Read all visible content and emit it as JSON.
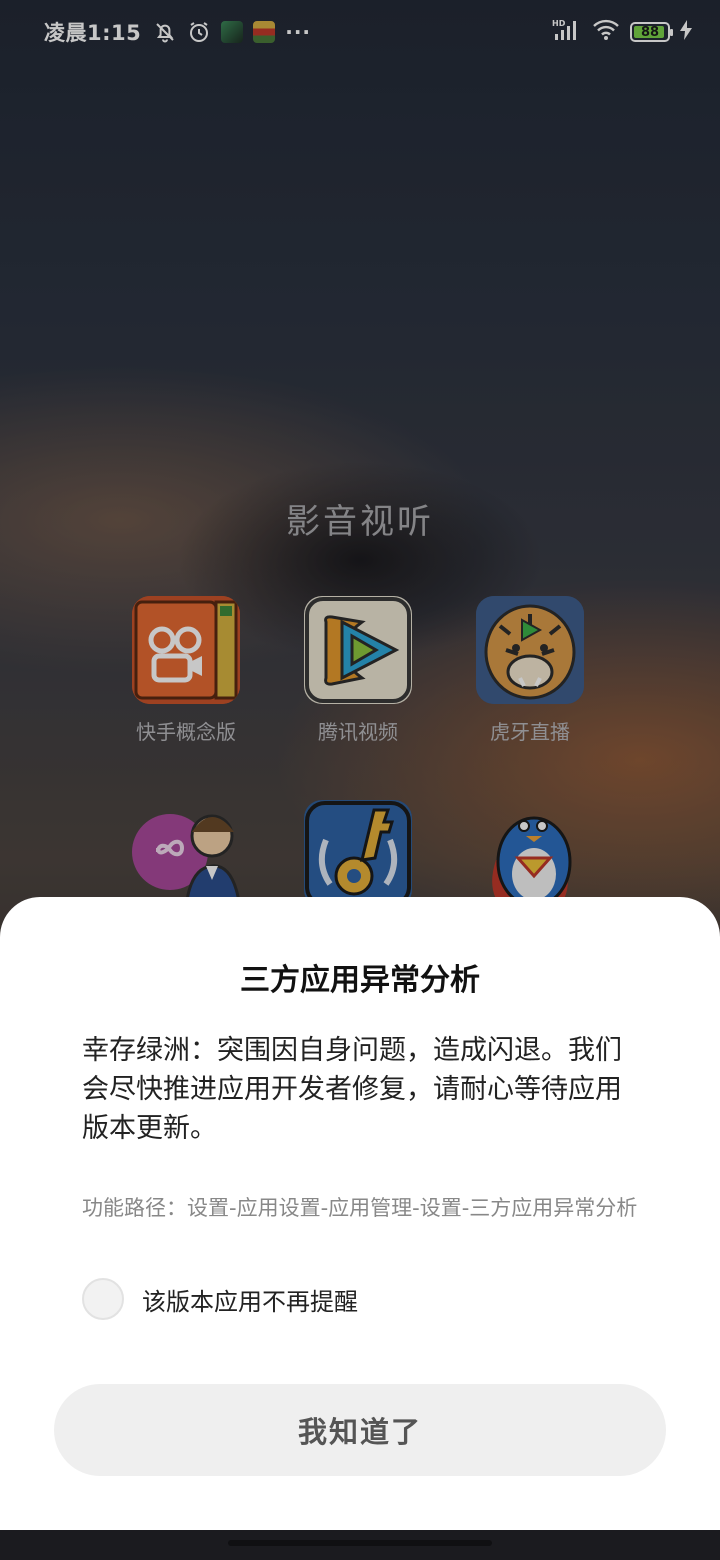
{
  "status_bar": {
    "time": "凌晨1:15",
    "icons": [
      "bell-off-icon",
      "alarm-icon",
      "app-notification-thumb-1",
      "app-notification-thumb-2"
    ],
    "more": "···",
    "network": "HD",
    "battery_level": "88",
    "charging": true
  },
  "folder": {
    "title": "影音视听",
    "apps": [
      {
        "label": "快手概念版",
        "icon": "kuaishou-concept-icon"
      },
      {
        "label": "腾讯视频",
        "icon": "tencent-video-icon"
      },
      {
        "label": "虎牙直播",
        "icon": "huya-live-icon"
      },
      {
        "label": "",
        "icon": "china-unicom-service-icon"
      },
      {
        "label": "",
        "icon": "key-app-icon"
      },
      {
        "label": "",
        "icon": "penguin-superhero-icon"
      }
    ]
  },
  "dialog": {
    "title": "三方应用异常分析",
    "message": "幸存绿洲：突围因自身问题，造成闪退。我们会尽快推进应用开发者修复，请耐心等待应用版本更新。",
    "path": "功能路径：设置-应用设置-应用管理-设置-三方应用异常分析",
    "checkbox_label": "该版本应用不再提醒",
    "checkbox_checked": false,
    "ok_button": "我知道了"
  },
  "colors": {
    "sheet_background": "#ffffff",
    "button_background": "#efefef",
    "battery_fill": "#7bd14a"
  }
}
